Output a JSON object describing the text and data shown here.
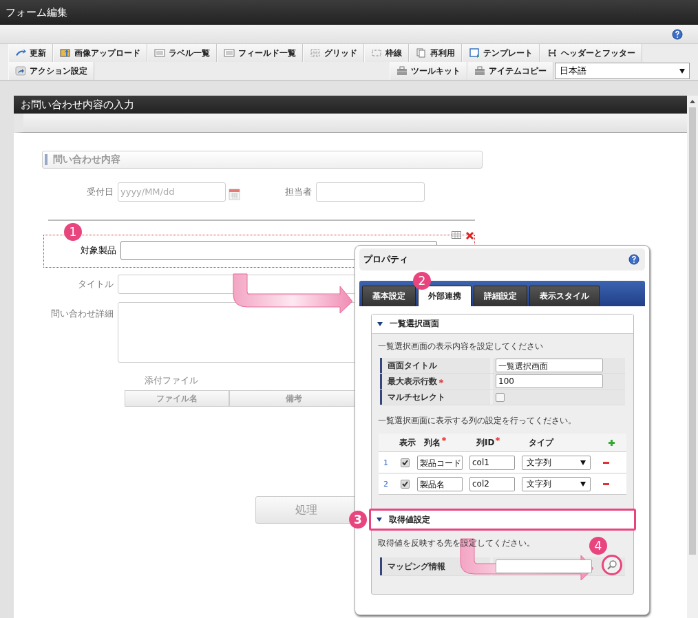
{
  "window": {
    "title": "フォーム編集"
  },
  "toolbar": {
    "main": [
      "更新",
      "画像アップロード",
      "ラベル一覧",
      "フィールド一覧",
      "グリッド",
      "枠線",
      "再利用",
      "テンプレート",
      "ヘッダーとフッター"
    ],
    "left": [
      "アクション設定"
    ],
    "right": [
      "ツールキット",
      "アイテムコピー"
    ],
    "language": "日本語"
  },
  "form": {
    "title": "お問い合わせ内容の入力",
    "section": "問い合わせ内容",
    "rows": [
      {
        "kind": "pair",
        "items": [
          {
            "label": "受付日",
            "placeholder": "yyyy/MM/dd"
          },
          {
            "label": "担当者"
          }
        ]
      },
      {
        "kind": "divider"
      },
      {
        "kind": "text",
        "label": "対象製品",
        "selected": true,
        "callout": "1"
      },
      {
        "kind": "text",
        "label": "タイトル",
        "selected": false
      },
      {
        "kind": "textarea",
        "label": "問い合わせ詳細"
      },
      {
        "kind": "table",
        "label": "添付ファイル",
        "columns": [
          "ファイル名",
          "備考"
        ]
      }
    ],
    "submit": "処理"
  },
  "properties": {
    "title": "プロパティ",
    "tabs": [
      {
        "label": "基本設定",
        "selected": false
      },
      {
        "label": "外部連携",
        "selected": true,
        "callout": "2"
      },
      {
        "label": "詳細設定",
        "selected": false
      },
      {
        "label": "表示スタイル",
        "selected": false
      }
    ],
    "sections": [
      {
        "kind": "list",
        "title": "一覧選択画面",
        "expanded": true,
        "highlighted": false,
        "description": "一覧選択画面の表示内容を設定してください",
        "props": [
          {
            "kind": "text",
            "label": "画面タイトル",
            "required": false,
            "value": "一覧選択画面"
          },
          {
            "kind": "text",
            "label": "最大表示行数",
            "required": true,
            "value": "100"
          },
          {
            "kind": "checkbox",
            "label": "マルチセレクト",
            "required": false,
            "checked": false
          }
        ],
        "table_note": "一覧選択画面に表示する列の設定を行ってください。",
        "table": {
          "columns": [
            {
              "label": "表示",
              "required": false
            },
            {
              "label": "列名",
              "required": true
            },
            {
              "label": "列ID",
              "required": true
            },
            {
              "label": "タイプ",
              "required": false
            }
          ],
          "rows": [
            {
              "index": "1",
              "shown": true,
              "name": "製品コード",
              "id": "col1",
              "type": "文字列"
            },
            {
              "index": "2",
              "shown": true,
              "name": "製品名",
              "id": "col2",
              "type": "文字列"
            }
          ]
        }
      },
      {
        "kind": "mapping",
        "title": "取得値設定",
        "expanded": true,
        "highlighted": true,
        "callout": "3",
        "description": "取得値を反映する先を設定してください。",
        "props": [
          {
            "kind": "search",
            "label": "マッピング情報",
            "required": false,
            "highlighted": true,
            "callout": "4"
          }
        ]
      }
    ]
  }
}
